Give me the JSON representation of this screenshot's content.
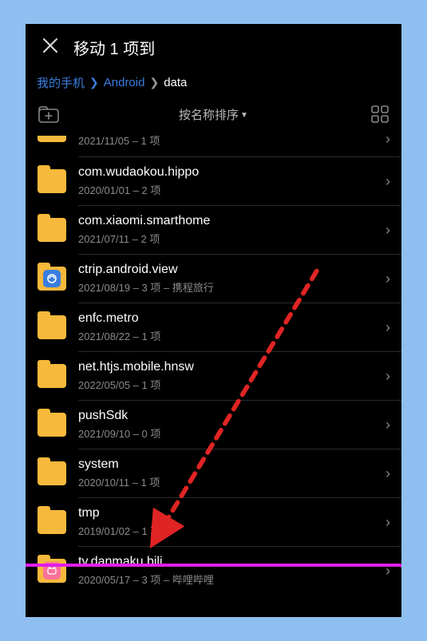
{
  "header": {
    "title": "移动 1 项到"
  },
  "breadcrumb": {
    "item1": "我的手机",
    "item2": "Android",
    "current": "data"
  },
  "toolbar": {
    "sort_label": "按名称排序"
  },
  "rows": [
    {
      "name": "",
      "meta": "2021/11/05 – 1 项",
      "icon": "folder",
      "partial": true
    },
    {
      "name": "com.wudaokou.hippo",
      "meta": "2020/01/01 – 2 项",
      "icon": "folder"
    },
    {
      "name": "com.xiaomi.smarthome",
      "meta": "2021/07/11 – 2 项",
      "icon": "folder"
    },
    {
      "name": "ctrip.android.view",
      "meta": "2021/08/19 – 3 项 – 携程旅行",
      "icon": "ctrip"
    },
    {
      "name": "enfc.metro",
      "meta": "2021/08/22 – 1 项",
      "icon": "folder"
    },
    {
      "name": "net.htjs.mobile.hnsw",
      "meta": "2022/05/05 – 1 项",
      "icon": "folder"
    },
    {
      "name": "pushSdk",
      "meta": "2021/09/10 – 0 项",
      "icon": "folder"
    },
    {
      "name": "system",
      "meta": "2020/10/11 – 1 项",
      "icon": "folder"
    },
    {
      "name": "tmp",
      "meta": "2019/01/02 – 1 项",
      "icon": "folder"
    },
    {
      "name": "tv.danmaku.bili",
      "meta": "2020/05/17 – 3 项 – 哔哩哔哩",
      "icon": "bili"
    }
  ],
  "annotation": {
    "arrow_color": "#e02424",
    "highlight_color": "#e11eeb"
  }
}
